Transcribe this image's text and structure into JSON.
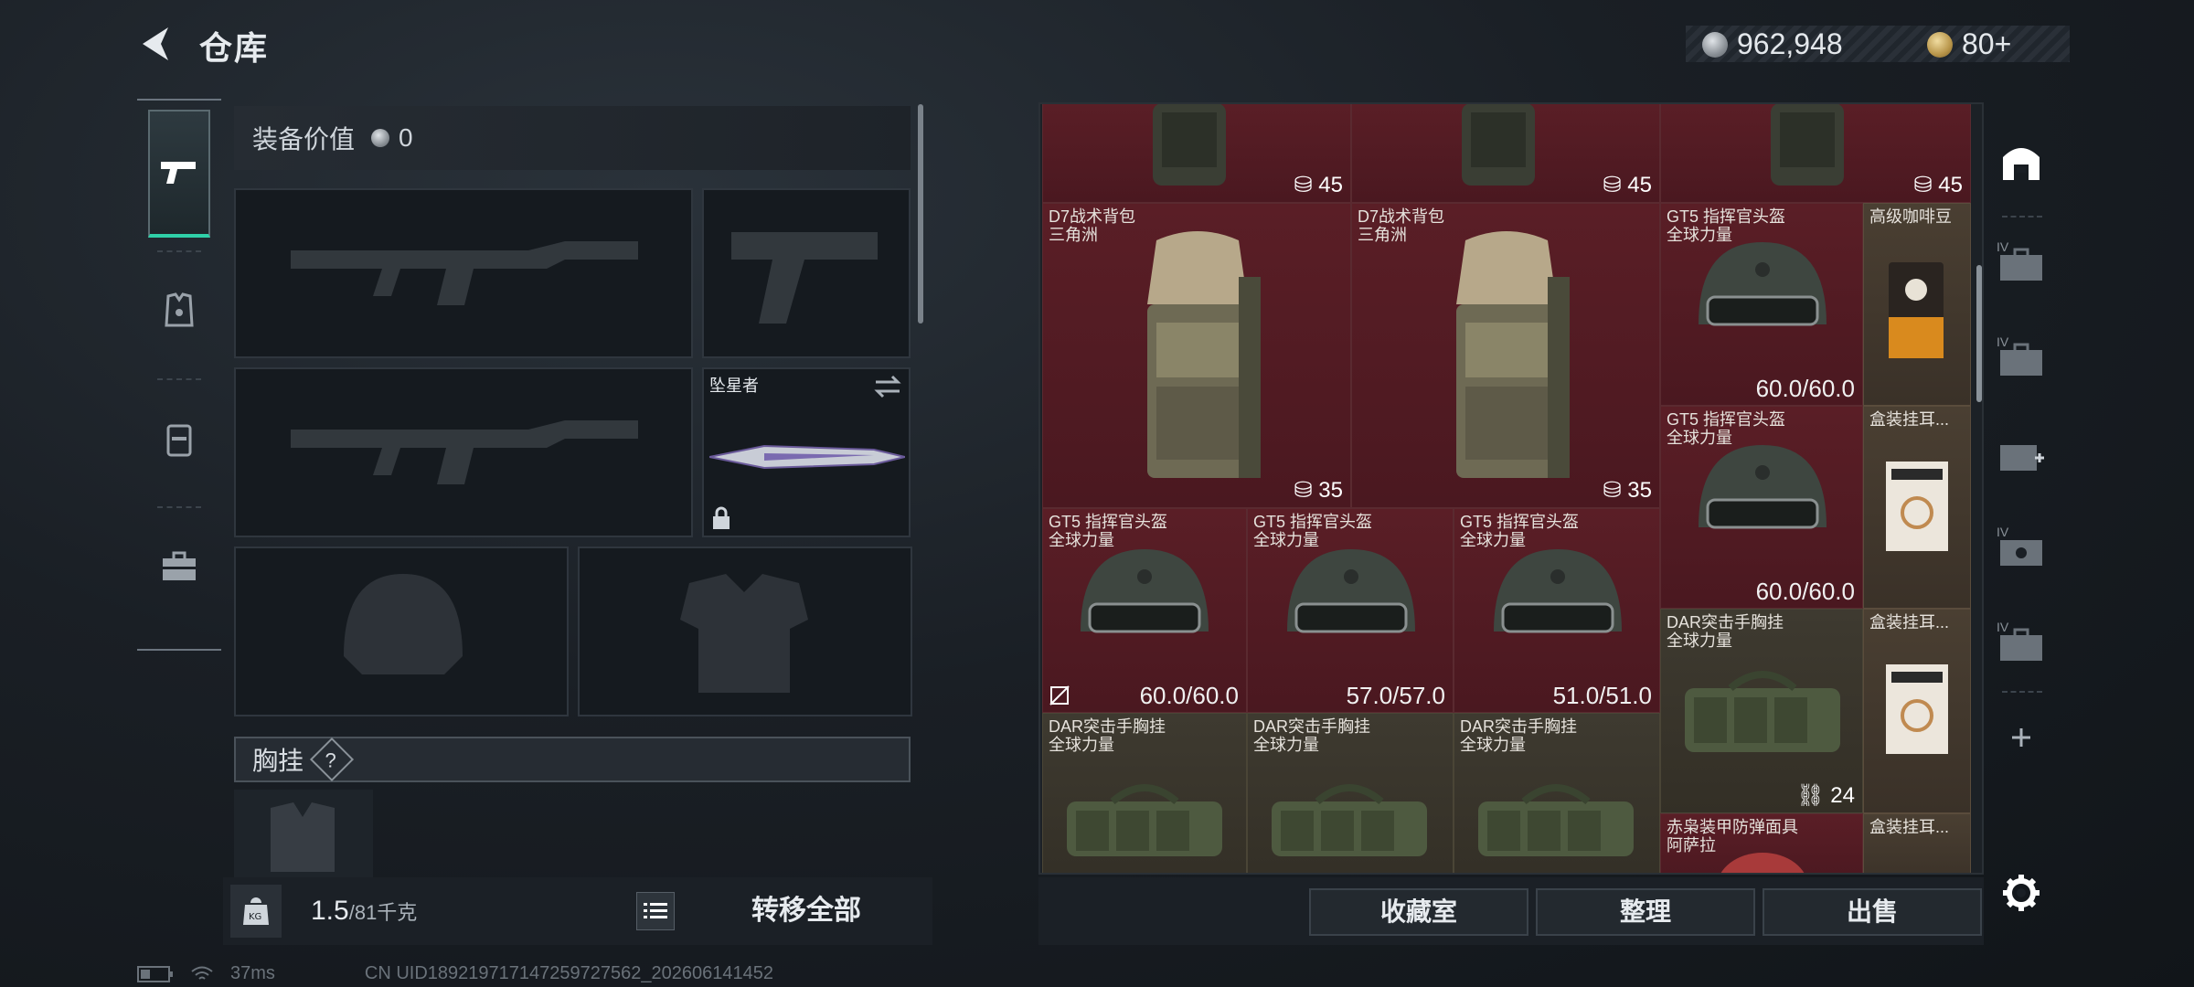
{
  "header": {
    "title": "仓库",
    "currency_silver": "962,948",
    "currency_gold": "80+"
  },
  "equipment": {
    "value_label": "装备价值",
    "value": "0",
    "melee_name": "坠星者",
    "chest_rig_label": "胸挂",
    "chest_rig_help": "?",
    "weight_current": "1.5",
    "weight_max": "/81千克",
    "transfer_all_label": "转移全部"
  },
  "inventory": {
    "items": [
      {
        "name": "",
        "sub": "",
        "count": "45"
      },
      {
        "name": "",
        "sub": "",
        "count": "45"
      },
      {
        "name": "",
        "sub": "",
        "count": "45"
      },
      {
        "name": "D7战术背包",
        "sub": "三角洲",
        "count": "35"
      },
      {
        "name": "D7战术背包",
        "sub": "三角洲",
        "count": "35"
      },
      {
        "name": "GT5 指挥官头盔",
        "sub": "全球力量",
        "durability": "60.0/60.0"
      },
      {
        "name": "高级咖啡豆",
        "sub": ""
      },
      {
        "name": "GT5 指挥官头盔",
        "sub": "全球力量",
        "durability": "60.0/60.0"
      },
      {
        "name": "盒装挂耳...",
        "sub": ""
      },
      {
        "name": "GT5 指挥官头盔",
        "sub": "全球力量",
        "durability": "60.0/60.0"
      },
      {
        "name": "GT5 指挥官头盔",
        "sub": "全球力量",
        "durability": "57.0/57.0"
      },
      {
        "name": "GT5 指挥官头盔",
        "sub": "全球力量",
        "durability": "51.0/51.0"
      },
      {
        "name": "DAR突击手胸挂",
        "sub": "全球力量",
        "count": "24"
      },
      {
        "name": "盒装挂耳...",
        "sub": ""
      },
      {
        "name": "DAR突击手胸挂",
        "sub": "全球力量"
      },
      {
        "name": "DAR突击手胸挂",
        "sub": "全球力量"
      },
      {
        "name": "DAR突击手胸挂",
        "sub": "全球力量"
      },
      {
        "name": "赤枭装甲防弹面具",
        "sub": "阿萨拉"
      },
      {
        "name": "盒装挂耳...",
        "sub": ""
      }
    ]
  },
  "actions": {
    "collection_label": "收藏室",
    "organize_label": "整理",
    "sell_label": "出售"
  },
  "rail": {
    "slot_label": "IV"
  },
  "status": {
    "ping": "37ms",
    "uid": "CN UID189219717147259727562_202606141452"
  },
  "colors": {
    "accent": "#2fd0a8",
    "rare_bg": "#5a1e26"
  }
}
